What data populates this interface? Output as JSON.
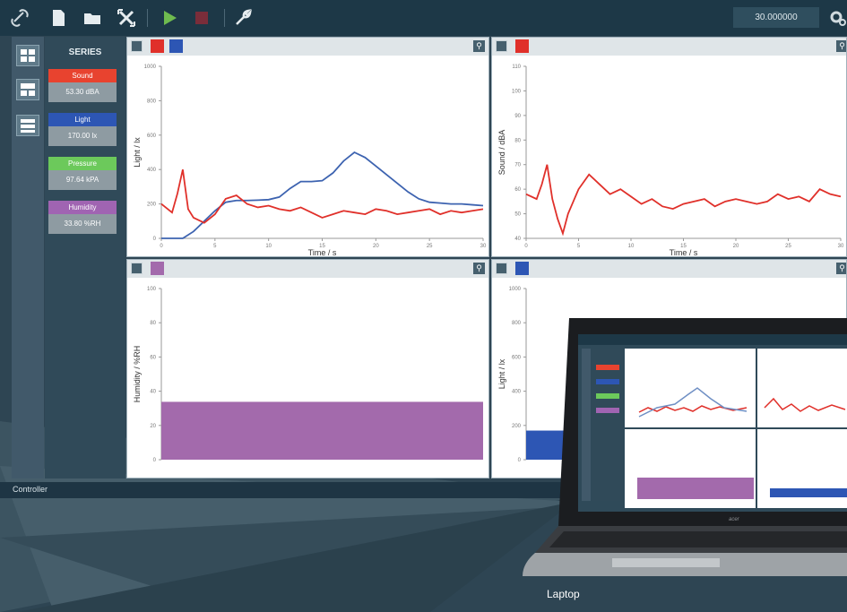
{
  "toolbar": {
    "icons": [
      "link-icon",
      "new-document-icon",
      "open-folder-icon",
      "clear-icon",
      "play-icon",
      "stop-icon",
      "settings-wrench-icon"
    ],
    "time_value": "30.000000",
    "gear_icon": "gear-icon"
  },
  "series_panel": {
    "heading": "SERIES",
    "items": [
      {
        "label": "Sound",
        "value": "53.30 dBA",
        "color": "#e8432f"
      },
      {
        "label": "Light",
        "value": "170.00 lx",
        "color": "#2d56b4"
      },
      {
        "label": "Pressure",
        "value": "97.64 kPA",
        "color": "#6cc95b"
      },
      {
        "label": "Humidity",
        "value": "33.80 %RH",
        "color": "#a064b2"
      }
    ]
  },
  "view_buttons": [
    "grid-view-icon",
    "split-view-icon",
    "list-view-icon"
  ],
  "colors": {
    "sound": "#e0302a",
    "light": "#3d63b0",
    "humidity": "#a36aac",
    "light_bar": "#2d56b4"
  },
  "chart_data": [
    {
      "type": "line",
      "xlabel": "Time / s",
      "ylabel": "Light / lx",
      "xlim": [
        0,
        30
      ],
      "ylim": [
        0,
        1000
      ],
      "x_ticks": [
        "0",
        "5",
        "10",
        "15",
        "20",
        "25",
        "30"
      ],
      "y_ticks": [
        "0",
        "200",
        "400",
        "600",
        "800",
        "1000"
      ],
      "series": [
        {
          "name": "Light",
          "x": [
            0,
            2,
            3,
            4,
            5,
            6,
            7,
            8,
            9,
            10,
            11,
            12,
            13,
            14,
            15,
            16,
            17,
            18,
            19,
            20,
            21,
            22,
            23,
            24,
            25,
            26,
            27,
            28,
            29,
            30
          ],
          "values": [
            0,
            0,
            40,
            100,
            160,
            210,
            220,
            220,
            222,
            225,
            240,
            290,
            330,
            330,
            335,
            380,
            450,
            500,
            470,
            420,
            370,
            320,
            270,
            230,
            210,
            205,
            200,
            200,
            195,
            190
          ]
        },
        {
          "name": "Sound",
          "x": [
            0,
            1,
            1.5,
            2,
            2.5,
            3,
            4,
            5,
            6,
            7,
            8,
            9,
            10,
            11,
            12,
            13,
            14,
            15,
            16,
            17,
            18,
            19,
            20,
            21,
            22,
            23,
            24,
            25,
            26,
            27,
            28,
            29,
            30
          ],
          "values": [
            200,
            150,
            260,
            400,
            170,
            120,
            90,
            140,
            230,
            250,
            200,
            180,
            190,
            170,
            160,
            180,
            150,
            120,
            140,
            160,
            150,
            140,
            170,
            160,
            140,
            150,
            160,
            170,
            140,
            160,
            150,
            160,
            170
          ]
        }
      ]
    },
    {
      "type": "line",
      "xlabel": "Time / s",
      "ylabel": "Sound / dBA",
      "xlim": [
        0,
        30
      ],
      "ylim": [
        40,
        110
      ],
      "x_ticks": [
        "0",
        "5",
        "10",
        "15",
        "20",
        "25",
        "30"
      ],
      "y_ticks": [
        "40",
        "50",
        "60",
        "70",
        "80",
        "90",
        "100",
        "110"
      ],
      "series": [
        {
          "name": "Sound",
          "x": [
            0,
            1,
            1.5,
            2,
            2.5,
            3,
            3.5,
            4,
            5,
            6,
            7,
            8,
            9,
            10,
            11,
            12,
            13,
            14,
            15,
            16,
            17,
            18,
            19,
            20,
            21,
            22,
            23,
            24,
            25,
            26,
            27,
            28,
            29,
            30
          ],
          "values": [
            58,
            56,
            62,
            70,
            56,
            48,
            42,
            50,
            60,
            66,
            62,
            58,
            60,
            57,
            54,
            56,
            53,
            52,
            54,
            55,
            56,
            53,
            55,
            56,
            55,
            54,
            55,
            58,
            56,
            57,
            55,
            60,
            58,
            57
          ]
        }
      ]
    },
    {
      "type": "bar",
      "ylabel": "Humidity / %RH",
      "ylim": [
        0,
        100
      ],
      "y_ticks": [
        "0",
        "20",
        "40",
        "60",
        "80",
        "100"
      ],
      "values": [
        33.8
      ]
    },
    {
      "type": "bar",
      "ylabel": "Light / lx",
      "ylim": [
        0,
        1000
      ],
      "y_ticks": [
        "0",
        "200",
        "400",
        "600",
        "800",
        "1000"
      ],
      "values": [
        170
      ]
    }
  ],
  "controller": {
    "label": "Controller"
  },
  "laptop": {
    "brand": "acer",
    "caption": "Laptop"
  }
}
